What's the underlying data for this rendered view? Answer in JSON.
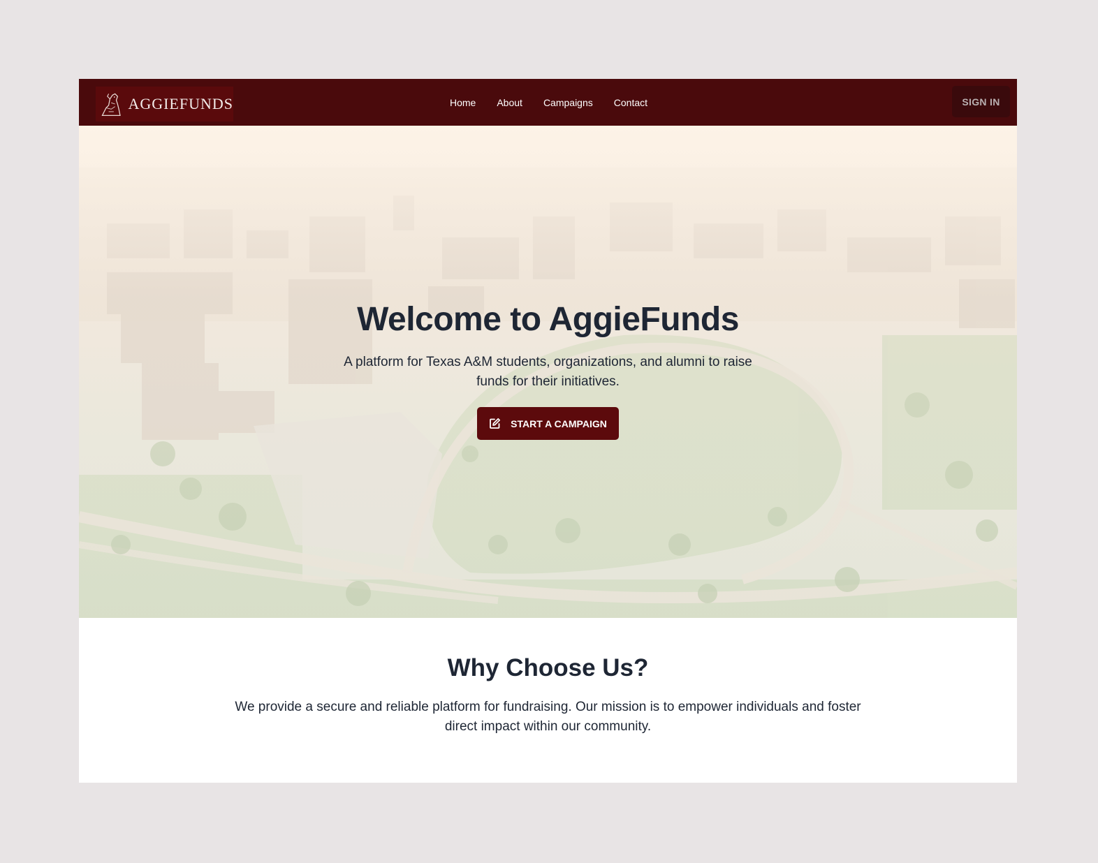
{
  "navbar": {
    "logo_text": "AGGIEFUNDS",
    "links": [
      "Home",
      "About",
      "Campaigns",
      "Contact"
    ],
    "signin_label": "SIGN IN"
  },
  "hero": {
    "title": "Welcome to AggieFunds",
    "subtitle": "A platform for Texas A&M students, organizations, and alumni to raise funds for their initiatives.",
    "cta_label": "START A CAMPAIGN",
    "cta_icon": "edit-icon"
  },
  "why": {
    "title": "Why Choose Us?",
    "text": "We provide a secure and reliable platform for fundraising. Our mission is to empower individuals and foster direct impact within our community."
  },
  "colors": {
    "maroon": "#4a0a0c",
    "button": "#5c0a0c",
    "text": "#1e2634"
  }
}
